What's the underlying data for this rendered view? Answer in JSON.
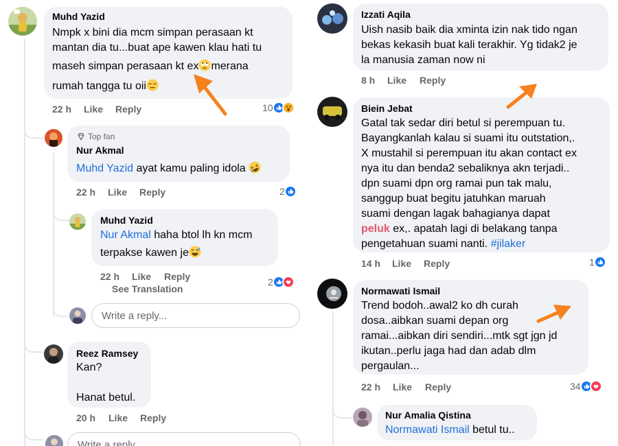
{
  "left": {
    "c1": {
      "author": "Muhd Yazid",
      "line1": "Nmpk x bini dia mcm simpan perasaan kt",
      "line2": "mantan dia tu...buat ape kawen klau hati tu",
      "line3": "maseh simpan perasaan kt ex",
      "line3b": "merana",
      "line4": "rumah tangga tu oii",
      "time": "22 h",
      "like": "Like",
      "reply": "Reply",
      "reactions": "10"
    },
    "c2": {
      "badge": "Top fan",
      "author": "Nur Akmal",
      "mention": "Muhd Yazid",
      "text": " ayat kamu paling idola ",
      "time": "22 h",
      "like": "Like",
      "reply": "Reply",
      "reactions": "2"
    },
    "c3": {
      "author": "Muhd Yazid",
      "mention": "Nur Akmal",
      "line1": " haha btol lh kn mcm",
      "line2": "terpakse kawen je",
      "time": "22 h",
      "like": "Like",
      "reply": "Reply",
      "see_translation": "See Translation",
      "reactions": "2"
    },
    "reply_placeholder": "Write a reply...",
    "c4": {
      "author": "Reez Ramsey",
      "line1": "Kan?",
      "line2": "Hanat betul.",
      "time": "20 h",
      "like": "Like",
      "reply": "Reply"
    },
    "reply_placeholder_2": "Write a reply..."
  },
  "right": {
    "c1": {
      "author": "Izzati Aqila",
      "line1": "Uish nasib baik dia xminta izin nak tido ngan",
      "line2": "bekas kekasih buat kali terakhir. Yg tidak2 je",
      "line3": "la manusia zaman now ni",
      "time": "8 h",
      "like": "Like",
      "reply": "Reply"
    },
    "c2": {
      "author": "Biein Jebat",
      "line1": "Gatal tak sedar diri betul si perempuan tu.",
      "line2": "Bayangkanlah kalau si suami itu outstation,.",
      "line3": "X mustahil si perempuan itu akan contact ex",
      "line4": "nya itu dan benda2 sebaliknya akn terjadi..",
      "line5": "dpn suami dpn org ramai pun tak malu,",
      "line6": "sanggup buat begitu jatuhkan maruah",
      "line7": "suami dengan lagak bahagianya dapat",
      "line8_hl": "peluk",
      "line8": " ex,. apatah lagi di belakang tanpa",
      "line9": "pengetahuan suami nanti. ",
      "hashtag": "#jilaker",
      "time": "14 h",
      "like": "Like",
      "reply": "Reply",
      "reactions": "1"
    },
    "c3": {
      "author": "Normawati Ismail",
      "line1": "Trend bodoh..awal2 ko dh curah",
      "line2": "dosa..aibkan suami depan org",
      "line3": "ramai...aibkan diri sendiri...mtk sgt jgn jd",
      "line4": "ikutan..perlu jaga had dan adab dlm",
      "line5": "pergaulan...",
      "time": "22 h",
      "like": "Like",
      "reply": "Reply",
      "reactions": "34"
    },
    "c4": {
      "author": "Nur Amalia Qistina",
      "mention": "Normawati Ismail",
      "text": " betul tu.."
    }
  },
  "colors": {
    "bubble": "#f0f2f5",
    "meta": "#65676b",
    "mention": "#216fdb",
    "highlight": "#e4576c",
    "arrow": "#f5821f",
    "like_blue": "#1877f2",
    "love_red": "#f33e58"
  },
  "icons": [
    "like-reaction-icon",
    "wow-reaction-icon",
    "love-reaction-icon",
    "rolling-eyes-emoji",
    "expressionless-emoji",
    "rofl-emoji",
    "sweat-smile-emoji",
    "top-fan-diamond-icon",
    "annotation-arrow"
  ]
}
